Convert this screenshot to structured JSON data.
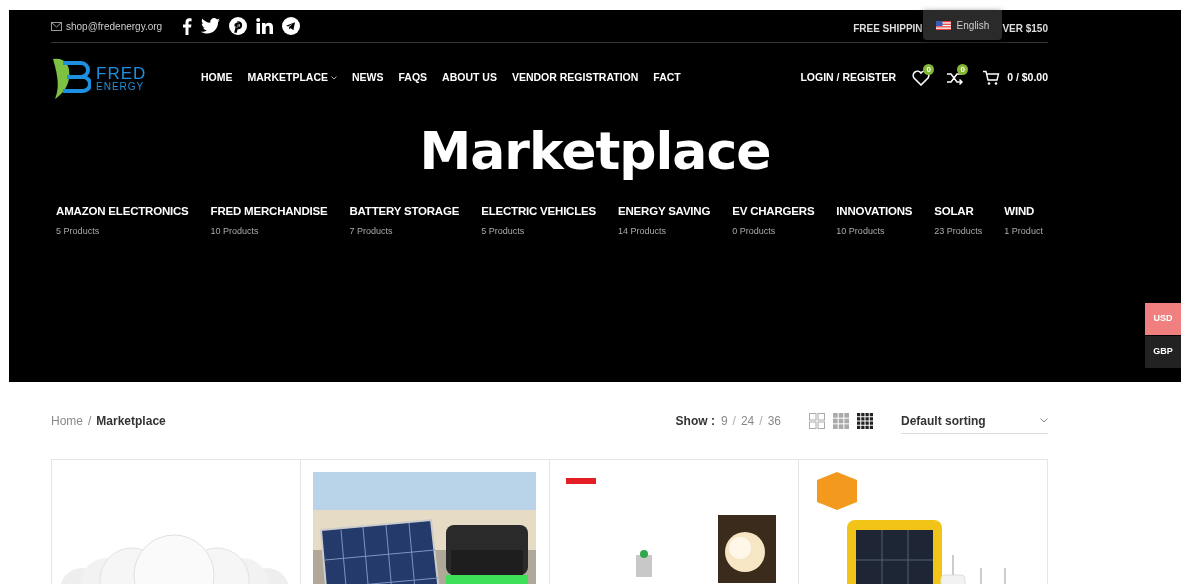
{
  "top_bar": {
    "email": "shop@fredenergy.org",
    "shipping_notice_parts": [
      "FREE SHIPPIN",
      "VER $150"
    ],
    "language": {
      "label": "English"
    }
  },
  "header": {
    "logo": {
      "line1": "FRED",
      "line2": "ENERGY"
    },
    "nav": [
      {
        "label": "HOME",
        "dropdown": false
      },
      {
        "label": "MARKETPLACE",
        "dropdown": true
      },
      {
        "label": "NEWS",
        "dropdown": false
      },
      {
        "label": "FAQS",
        "dropdown": false
      },
      {
        "label": "ABOUT US",
        "dropdown": false
      },
      {
        "label": "VENDOR REGISTRATION",
        "dropdown": false
      },
      {
        "label": "FACT",
        "dropdown": false
      }
    ],
    "account": "LOGIN / REGISTER",
    "wishlist_count": "0",
    "compare_count": "0",
    "cart": "0 / $0.00"
  },
  "hero": {
    "title": "Marketplace",
    "categories": [
      {
        "name": "AMAZON ELECTRONICS",
        "count": "5 Products"
      },
      {
        "name": "FRED MERCHANDISE",
        "count": "10 Products"
      },
      {
        "name": "BATTERY STORAGE",
        "count": "7 Products"
      },
      {
        "name": "ELECTRIC VEHICLES",
        "count": "5 Products"
      },
      {
        "name": "ENERGY SAVING",
        "count": "14 Products"
      },
      {
        "name": "EV CHARGERS",
        "count": "0 Products"
      },
      {
        "name": "INNOVATIONS",
        "count": "10 Products"
      },
      {
        "name": "SOLAR",
        "count": "23 Products"
      },
      {
        "name": "WIND",
        "count": "1 Product"
      }
    ]
  },
  "currency_switcher": [
    {
      "label": "USD",
      "selected": true
    },
    {
      "label": "GBP",
      "selected": false
    }
  ],
  "toolbar": {
    "breadcrumb": [
      {
        "label": "Home",
        "current": false,
        "separator": "/"
      },
      {
        "label": "Marketplace",
        "current": true
      }
    ],
    "show_label": "Show :",
    "per_page": [
      {
        "label": "9",
        "separator": "/"
      },
      {
        "label": "24",
        "separator": "/"
      },
      {
        "label": "36"
      }
    ],
    "view_modes": [
      {
        "kind": "grid2",
        "selected": false
      },
      {
        "kind": "grid3",
        "selected": false
      },
      {
        "kind": "grid4",
        "selected": true
      }
    ],
    "sorting": "Default sorting"
  }
}
